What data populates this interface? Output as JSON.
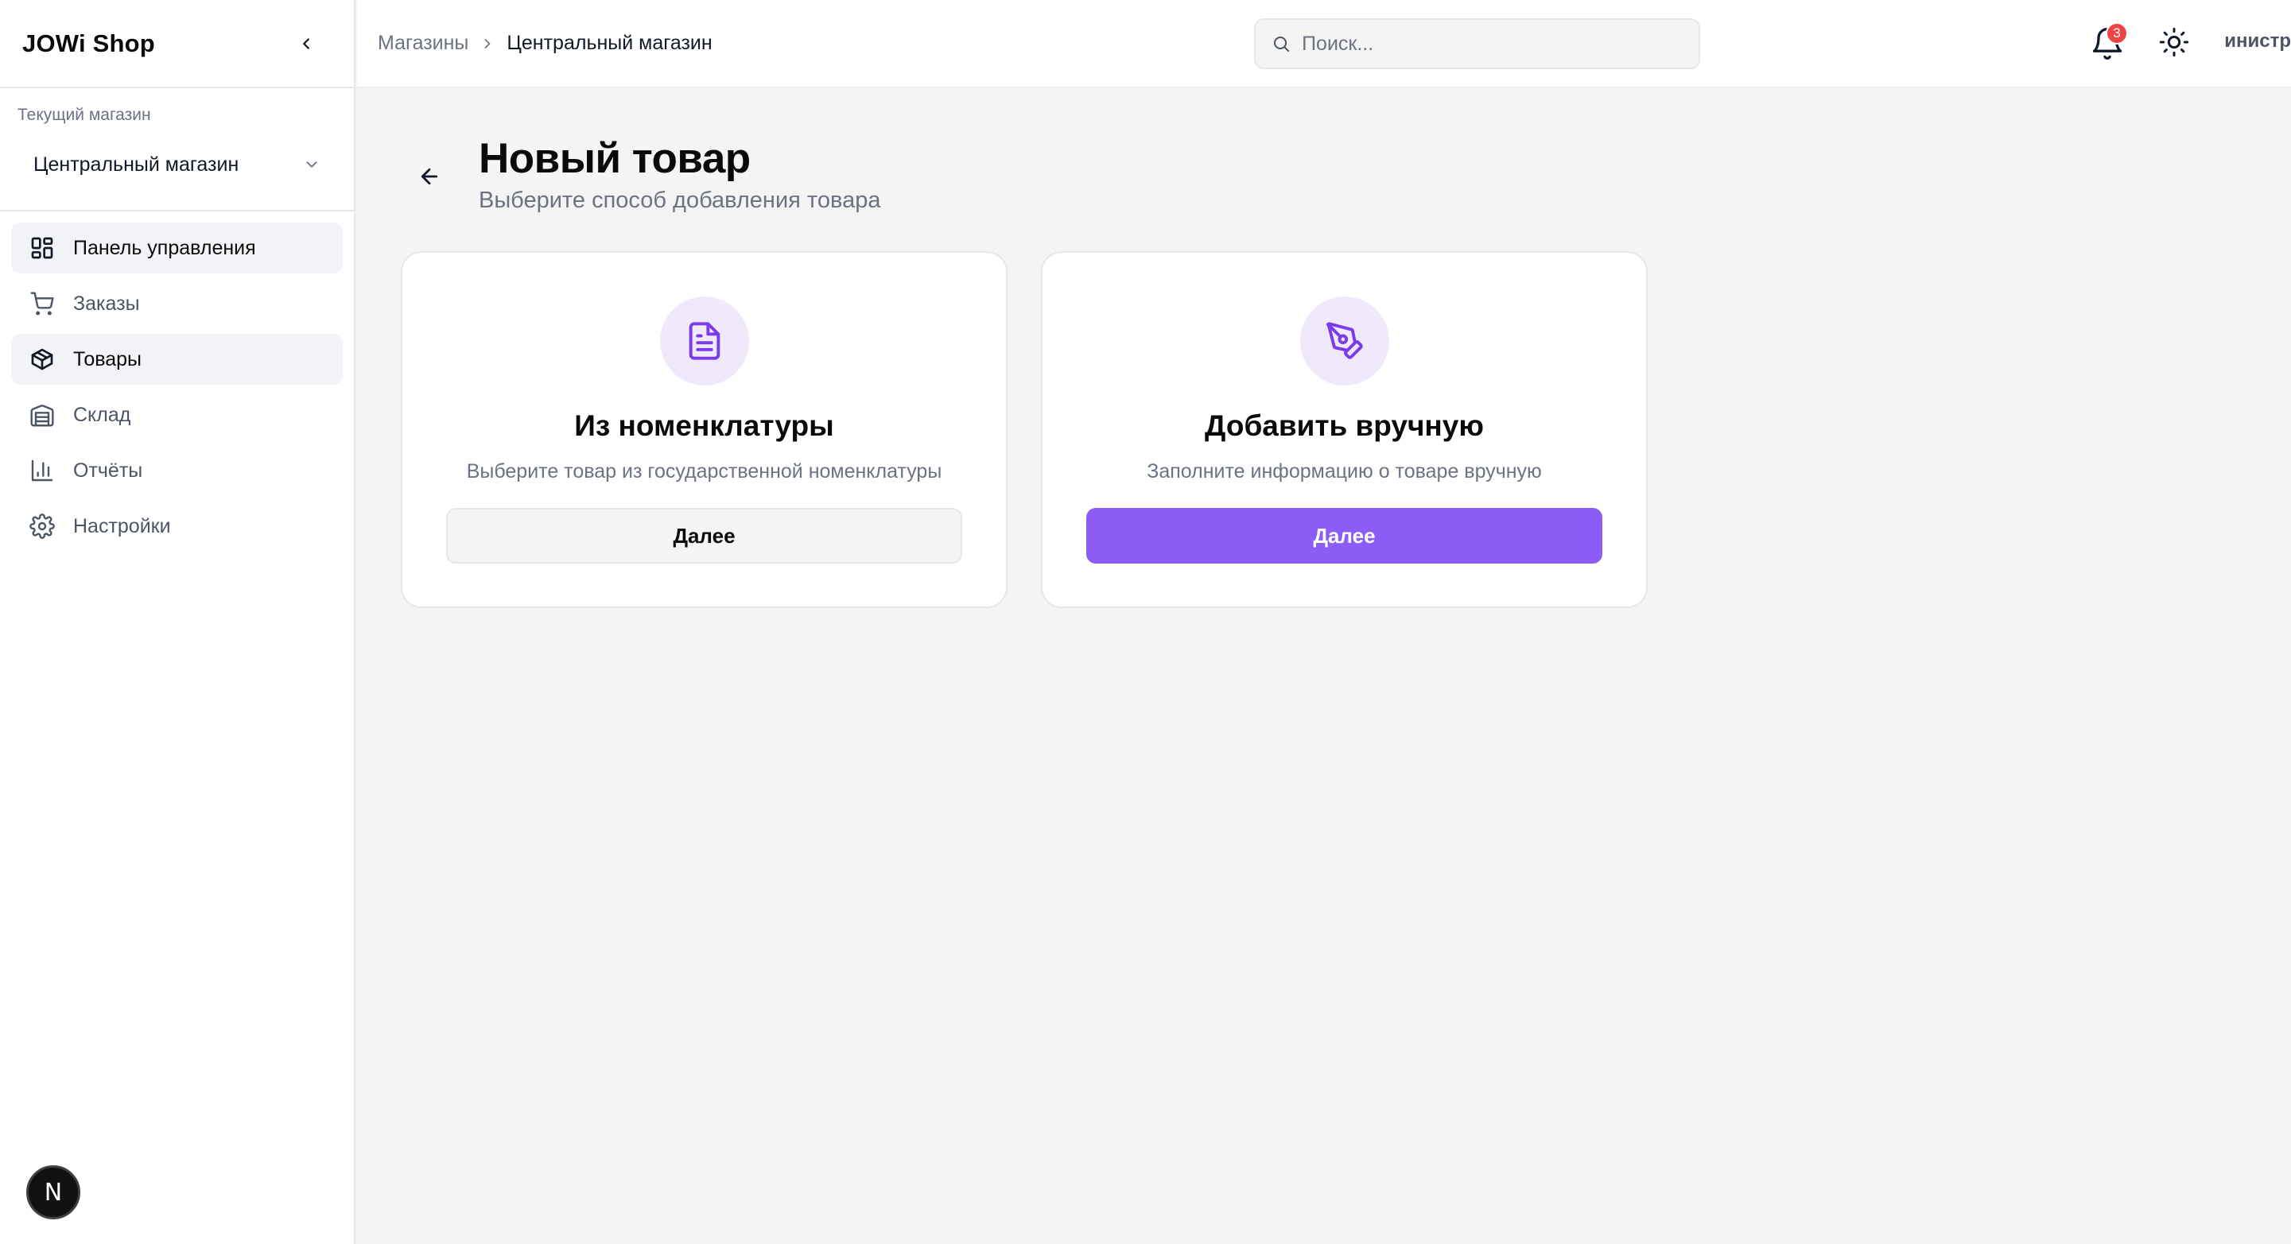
{
  "app": {
    "brand": "JOWi Shop"
  },
  "sidebar": {
    "store_caption": "Текущий магазин",
    "store_selected": "Центральный магазин",
    "items": [
      {
        "label": "Панель управления",
        "icon": "layout-dashboard-icon"
      },
      {
        "label": "Заказы",
        "icon": "shopping-cart-icon"
      },
      {
        "label": "Товары",
        "icon": "package-icon"
      },
      {
        "label": "Склад",
        "icon": "warehouse-icon"
      },
      {
        "label": "Отчёты",
        "icon": "bar-chart-icon"
      },
      {
        "label": "Настройки",
        "icon": "settings-gear-icon"
      }
    ],
    "badge_letter": "N"
  },
  "header": {
    "breadcrumb": [
      "Магазины",
      "Центральный магазин"
    ],
    "search_placeholder": "Поиск...",
    "notifications_count": "3",
    "user_label_visible": "инистр"
  },
  "page": {
    "title": "Новый товар",
    "subtitle": "Выберите способ добавления товара"
  },
  "options": [
    {
      "title": "Из номенклатуры",
      "description": "Выберите товар из государственной номенклатуры",
      "button": "Далее",
      "icon": "file-text-icon"
    },
    {
      "title": "Добавить вручную",
      "description": "Заполните информацию о товаре вручную",
      "button": "Далее",
      "icon": "pen-tool-icon"
    }
  ],
  "colors": {
    "accent": "#8b5cf6",
    "accent_soft": "#efe9fb",
    "badge": "#ef4444",
    "background": "#f4f4f5"
  }
}
